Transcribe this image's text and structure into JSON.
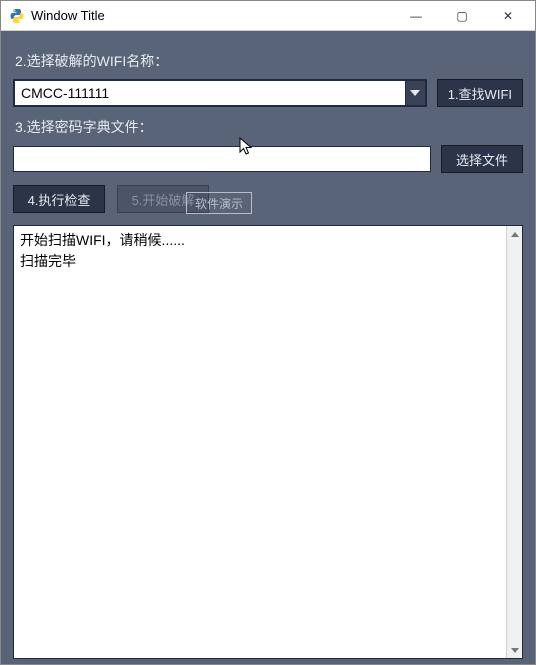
{
  "window": {
    "title": "Window Title"
  },
  "labels": {
    "wifi_name": "2.选择破解的WIFI名称：",
    "dict_file": "3.选择密码字典文件："
  },
  "combo": {
    "value": "CMCC-111111"
  },
  "dict_input": {
    "value": ""
  },
  "buttons": {
    "find_wifi": "1.查找WIFI",
    "choose_file": "选择文件",
    "run_check": "4.执行检查",
    "start_crack": "5.开始破解"
  },
  "log_text": "开始扫描WIFI，请稍候......\n扫描完毕",
  "watermark": "软件演示"
}
